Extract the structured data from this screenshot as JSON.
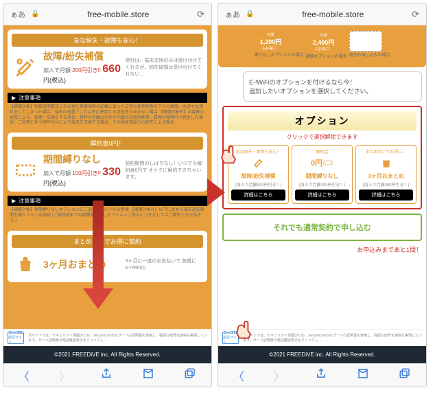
{
  "browser": {
    "aa": "ぁあ",
    "url": "free-mobile.store"
  },
  "left": {
    "hdr1": "急な紛失・故障も安心！",
    "c1": {
      "title": "故障/紛失補償",
      "sub": "加入で月額",
      "strike": "200円引き!!",
      "price": "660",
      "unit": "円(税込)",
      "desc": "他社は、端末交換のみは受け付けてくれるが、紛失破損は受け付けてくれない…"
    },
    "noticeHdr": "注意事項",
    "notice1": "【補償対象】取扱説明書及びその他注意事項等の記載に従った正常な使用状態の下での故障、水没や水濡れをしてしまった場合、端末の改置でこれ以外に使用する可能性がほぼない場合\n【補償対象外】お客様の故意による、修理・交換をする場合、経年や外観の劣化や内部の自然消耗等、異物が標準内で発生した場合、ご利用に伴う経年劣化により端末を交換する場合、その他故意誤りの紛失による場合",
    "hdr2": "解約金0円！",
    "c2": {
      "title": "期間縛りなし",
      "sub": "加入で月額",
      "strike": "100円引き!!",
      "price": "330",
      "unit": "円(税込)",
      "desc": "契約期間のしばりなし！いつでも解約金0円で オトクに解約できちゃいます。"
    },
    "notice2": "【補償対象】期間縛りなしオプションにご加入いただいたお客様\n【補償対象外】以下に定める端末返送期間を満たさないお客様\n(ご契約途中での期間縛りなしオプションご加入につきましてはご解約できかねます。)",
    "hdr3": "まとめ払いでお得に契約",
    "c3": {
      "title": "3ヶ月おまとめ",
      "desc": "3ヶ月に一度のお支払いで 気軽にE-!WiFiの"
    }
  },
  "right": {
    "trio": [
      {
        "top": "年間",
        "price": "1,200円",
        "sub": "もお得に！",
        "label": "縛りなしオプションの場合"
      },
      {
        "top": "年間",
        "price": "2,400円",
        "sub": "もお得に！",
        "label": "補償オプションの場合"
      },
      {
        "label": "両方お申し込みの場合"
      }
    ],
    "bubble": "E-!WiFiのオプションを付けるなら今！\n追加したいオプションを選択してください。",
    "optTitle": "オプション",
    "optSub": "クリックで選択解除できます",
    "opts": [
      {
        "tag": "急な紛失・故障も安心！",
        "title": "故障/紛失補償",
        "sub": "(加入で月額200円引き！)",
        "btn": "詳細はこちら"
      },
      {
        "tag": "解約金",
        "zero": "0円",
        "title": "期間縛りなし",
        "sub": "(加入で月額100円引き！)",
        "btn": "詳細はこちら"
      },
      {
        "tag": "まとめ払いでお得に！",
        "title": "3ヶ月おまとめ",
        "sub": "(加入で月額300円引き！)",
        "btn": "詳細はこちら"
      }
    ],
    "greenBtn": "それでも通常契約で申し込む",
    "warn": "お申込みまであと1問！"
  },
  "ssl": {
    "logo": "CoreSSL",
    "logoSub": "認証サイト",
    "text": "当サイトでは、セキュリティ保護のため、SecureCoreSSLサーバの証明書を使用し、強固な暗号化通信を実現しています。サーバ証明書の暗証確認表示をクリックし…"
  },
  "footer": "©2021 FREEDiVE inc. All Rights Reserved."
}
